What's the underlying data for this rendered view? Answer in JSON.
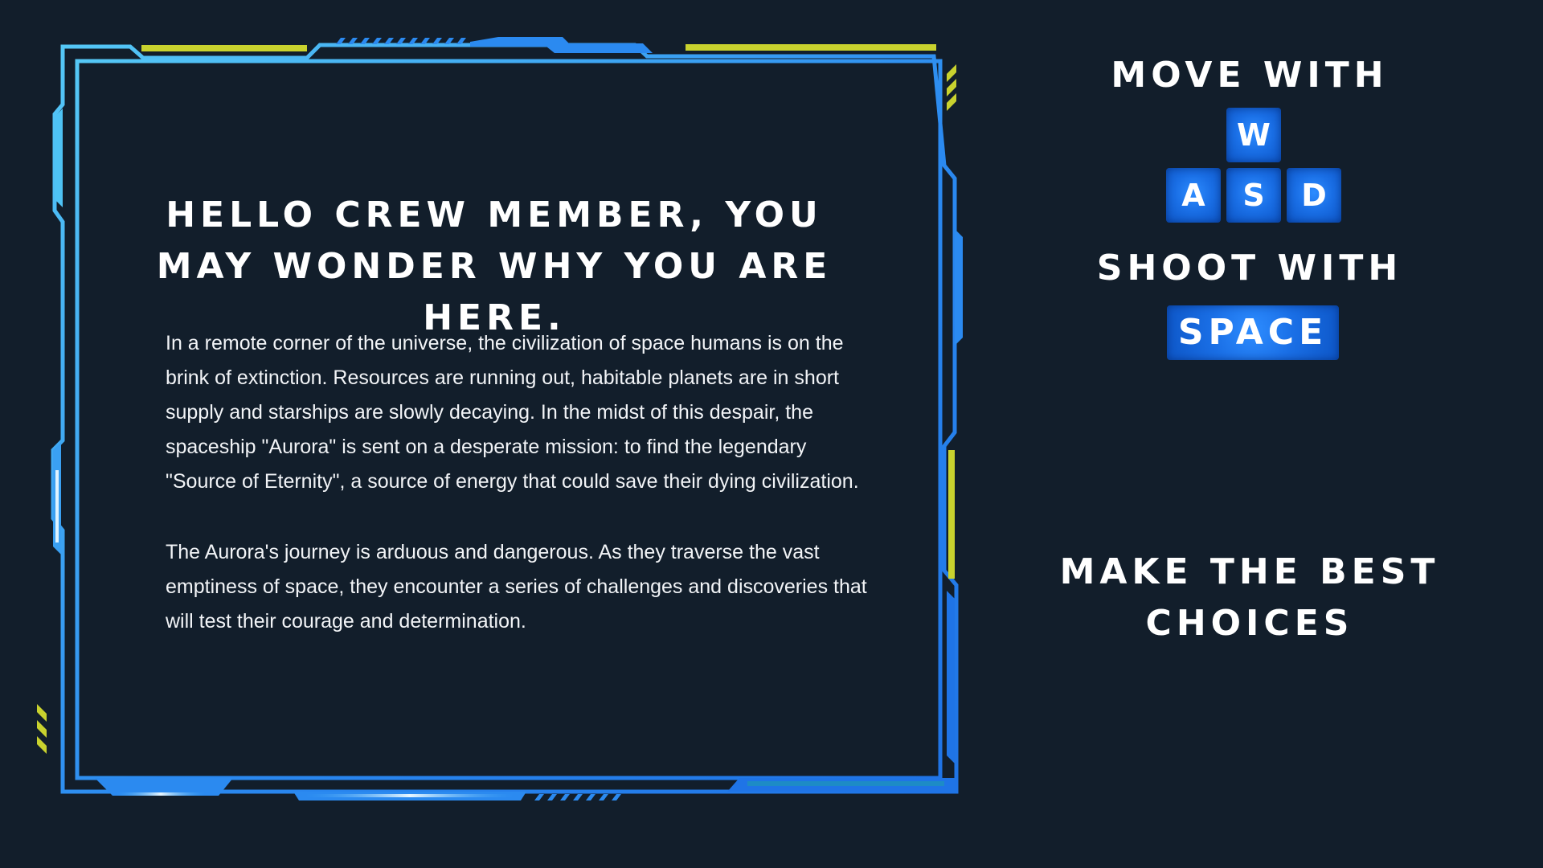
{
  "story": {
    "heading": "HELLO CREW MEMBER, YOU MAY WONDER WHY YOU ARE HERE.",
    "paragraphs": [
      "In a remote corner of the universe, the civilization of space humans is on the brink of extinction. Resources are running out, habitable planets are in short supply and starships are slowly decaying. In the midst of this despair, the spaceship \"Aurora\" is sent on a desperate mission: to find the legendary \"Source of Eternity\", a source of energy that could save their dying civilization.",
      "The Aurora's journey is arduous and dangerous. As they traverse the vast emptiness of space, they encounter a series of challenges and discoveries that will test their courage and determination."
    ]
  },
  "controls": {
    "move_label": "MOVE WITH",
    "move_keys": {
      "up": "W",
      "left": "A",
      "down": "S",
      "right": "D"
    },
    "shoot_label": "SHOOT WITH",
    "shoot_key": "SPACE",
    "tip": "MAKE THE BEST CHOICES"
  },
  "colors": {
    "background": "#121e2b",
    "frame_blue": "#2b8af0",
    "frame_light_blue": "#4ec3f5",
    "accent_yellow": "#c9d22e",
    "key_blue": "#1a6fe6",
    "text": "#ffffff"
  }
}
